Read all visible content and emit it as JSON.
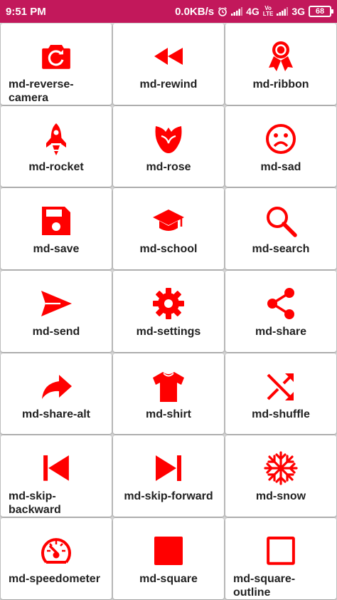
{
  "status_bar": {
    "time": "9:51 PM",
    "speed": "0.0KB/s",
    "net1": "4G",
    "volte_top": "Vo",
    "volte_bottom": "LTE",
    "net2": "3G",
    "battery": "68"
  },
  "colors": {
    "accent": "#c2185b",
    "icon": "#ff0000",
    "text": "#222222"
  },
  "icons": [
    {
      "label": "md-reverse-camera",
      "icon": "reverse-camera-icon"
    },
    {
      "label": "md-rewind",
      "icon": "rewind-icon"
    },
    {
      "label": "md-ribbon",
      "icon": "ribbon-icon"
    },
    {
      "label": "md-rocket",
      "icon": "rocket-icon"
    },
    {
      "label": "md-rose",
      "icon": "rose-icon"
    },
    {
      "label": "md-sad",
      "icon": "sad-icon"
    },
    {
      "label": "md-save",
      "icon": "save-icon"
    },
    {
      "label": "md-school",
      "icon": "school-icon"
    },
    {
      "label": "md-search",
      "icon": "search-icon"
    },
    {
      "label": "md-send",
      "icon": "send-icon"
    },
    {
      "label": "md-settings",
      "icon": "settings-icon"
    },
    {
      "label": "md-share",
      "icon": "share-icon"
    },
    {
      "label": "md-share-alt",
      "icon": "share-alt-icon"
    },
    {
      "label": "md-shirt",
      "icon": "shirt-icon"
    },
    {
      "label": "md-shuffle",
      "icon": "shuffle-icon"
    },
    {
      "label": "md-skip-backward",
      "icon": "skip-backward-icon"
    },
    {
      "label": "md-skip-forward",
      "icon": "skip-forward-icon"
    },
    {
      "label": "md-snow",
      "icon": "snow-icon"
    },
    {
      "label": "md-speedometer",
      "icon": "speedometer-icon"
    },
    {
      "label": "md-square",
      "icon": "square-icon"
    },
    {
      "label": "md-square-outline",
      "icon": "square-outline-icon"
    }
  ]
}
